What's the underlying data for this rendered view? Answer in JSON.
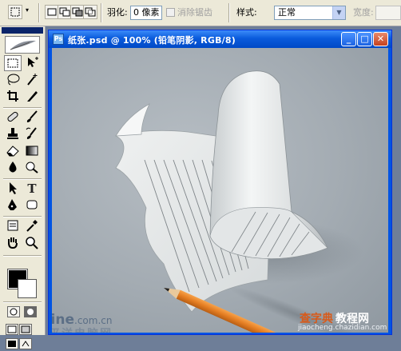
{
  "options_bar": {
    "feather_label": "羽化:",
    "feather_value": "0 像素",
    "antialias_label": "消除锯齿",
    "style_label": "样式:",
    "style_value": "正常",
    "width_label": "宽度:"
  },
  "document": {
    "title": "纸张.psd @ 100% (铅笔阴影, RGB/8)"
  },
  "colors": {
    "titlebar": "#0a5bdc",
    "paper": "#e6e9ea",
    "pencil": "#e8822a",
    "canvas": "#a3abb2"
  },
  "watermarks": {
    "left_brand": "PConline",
    "left_domain": ".com.cn",
    "left_cn": "太平洋电脑网",
    "right_cn": "查字典",
    "right_cn2": "教程网",
    "right_url": "jiaocheng.chazidian.com"
  }
}
